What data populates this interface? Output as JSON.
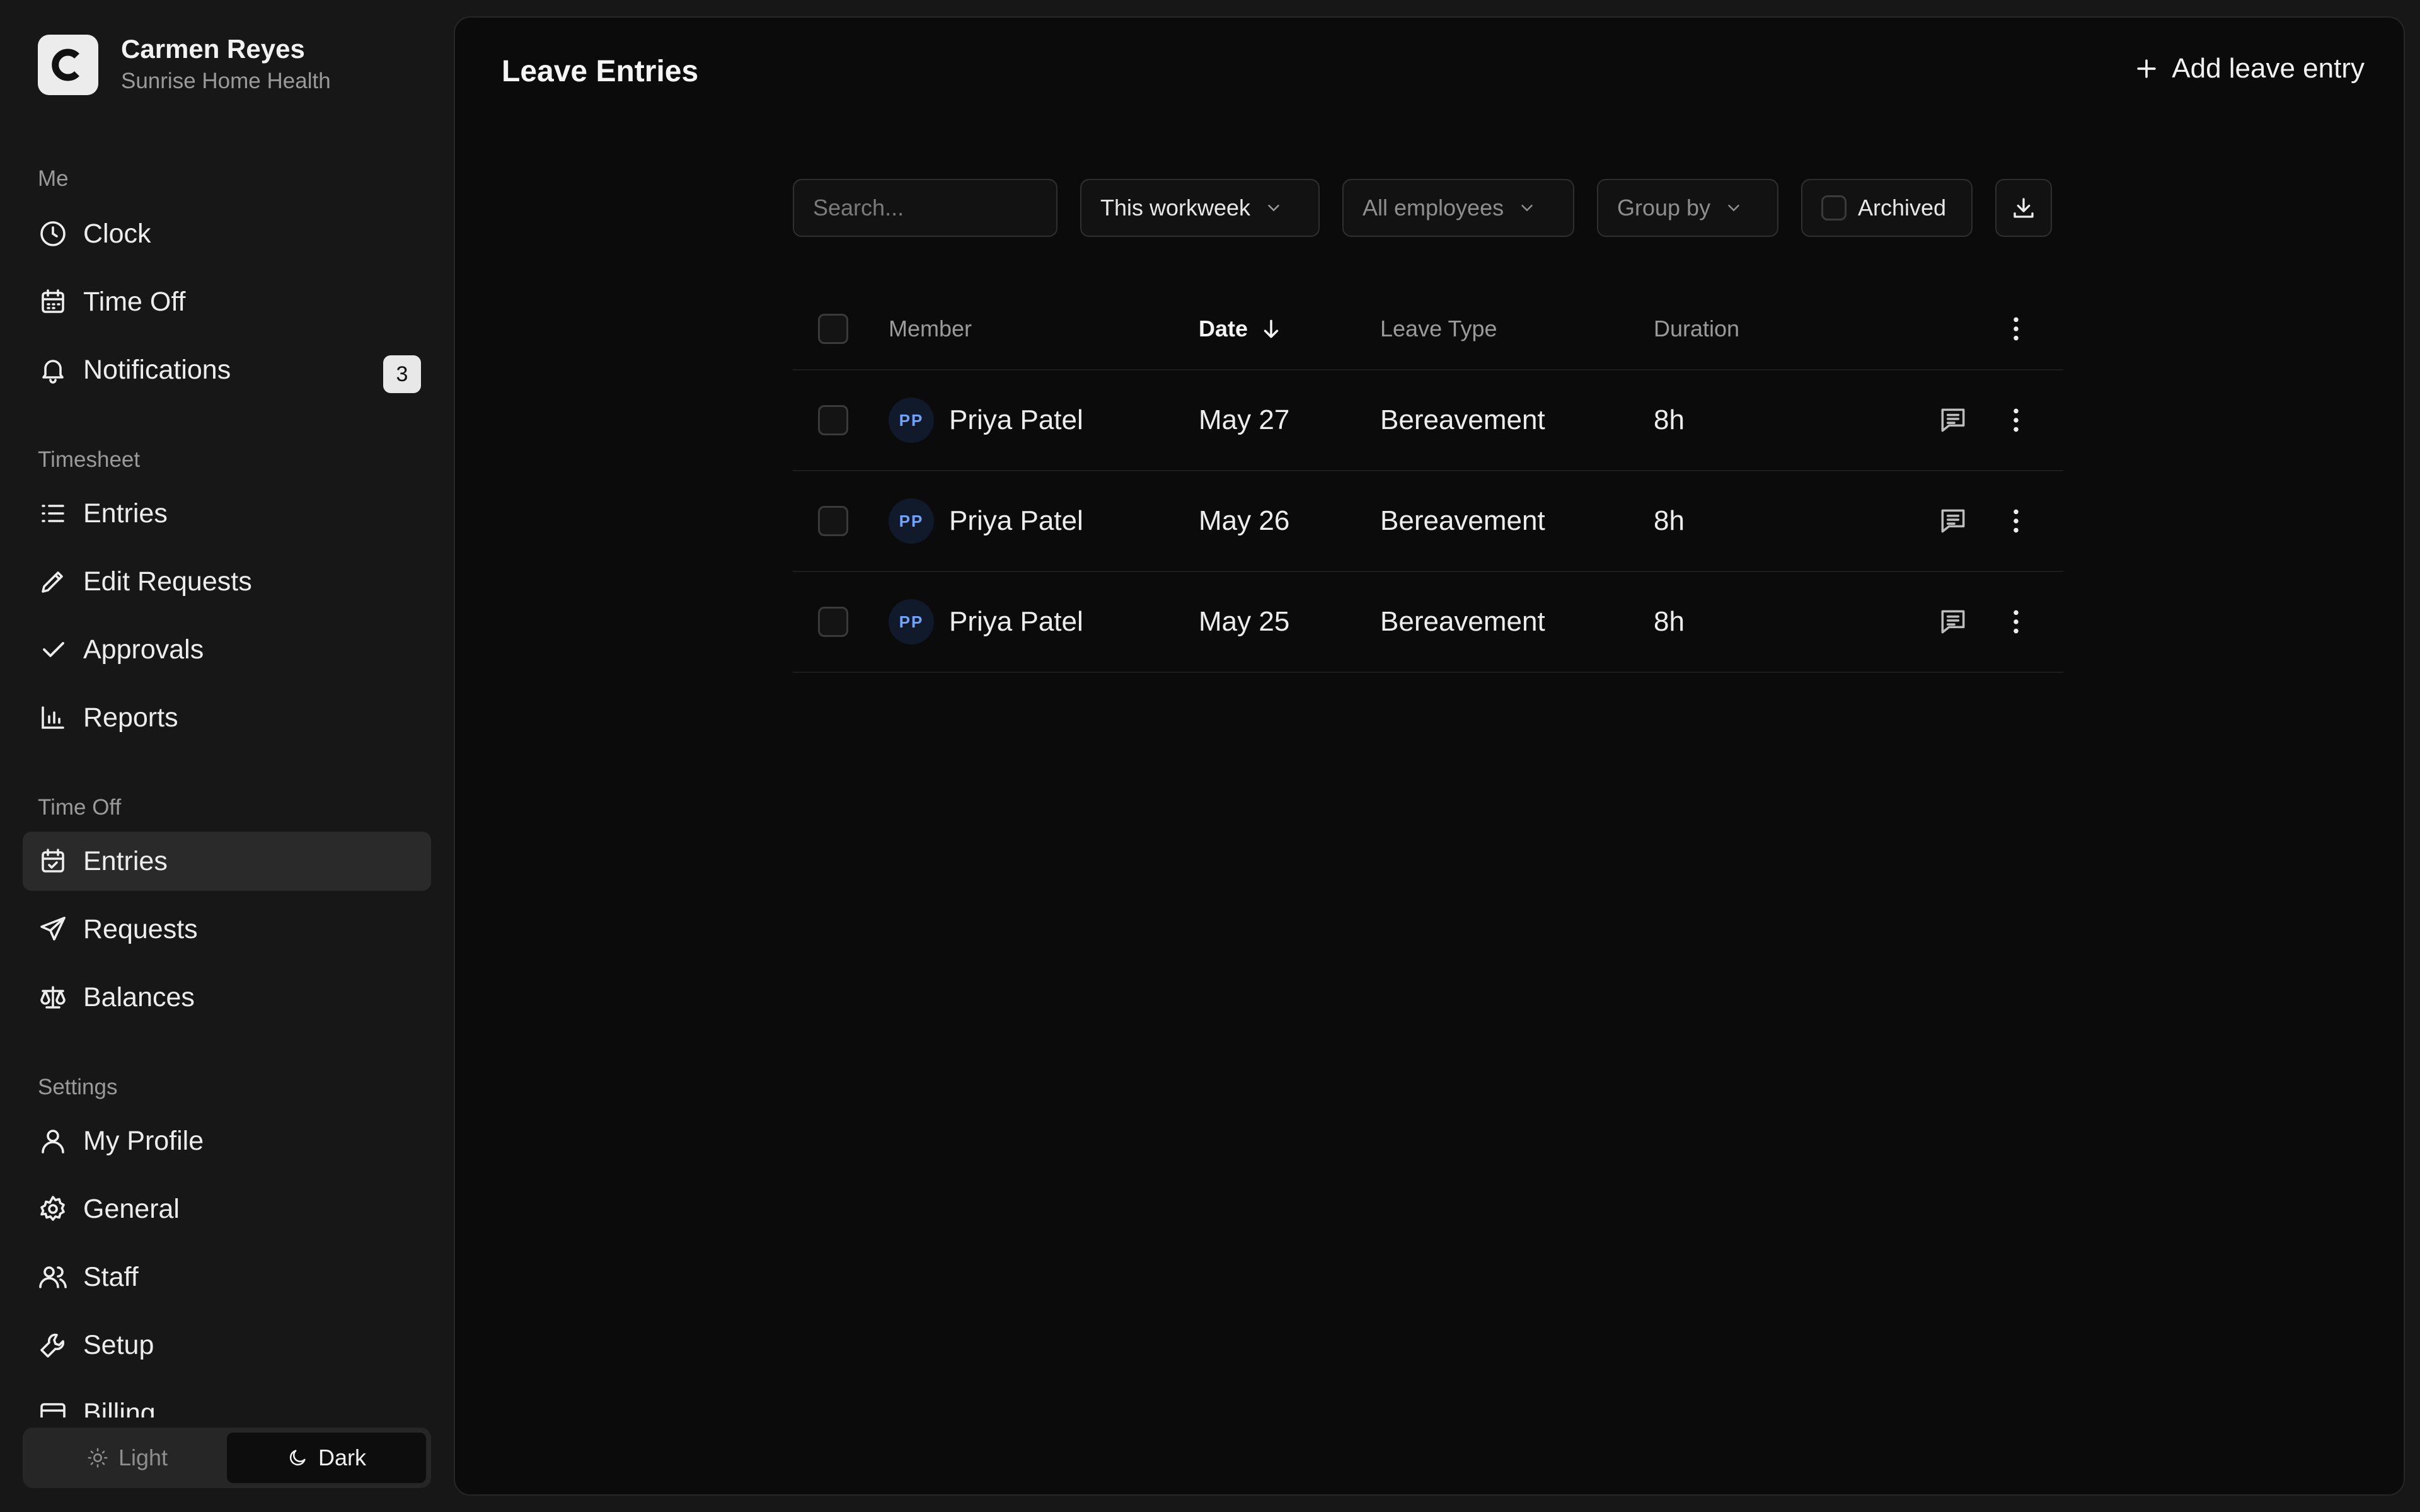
{
  "account": {
    "logo_letter": "C",
    "name": "Carmen Reyes",
    "org": "Sunrise Home Health"
  },
  "sidebar": {
    "sections": [
      {
        "label": "Me",
        "items": [
          {
            "label": "Clock",
            "icon": "clock-icon"
          },
          {
            "label": "Time Off",
            "icon": "calendar-icon"
          },
          {
            "label": "Notifications",
            "icon": "bell-icon",
            "badge": "3"
          }
        ]
      },
      {
        "label": "Timesheet",
        "items": [
          {
            "label": "Entries",
            "icon": "list-icon"
          },
          {
            "label": "Edit Requests",
            "icon": "pencil-icon"
          },
          {
            "label": "Approvals",
            "icon": "check-icon"
          },
          {
            "label": "Reports",
            "icon": "bar-chart-icon"
          }
        ]
      },
      {
        "label": "Time Off",
        "items": [
          {
            "label": "Entries",
            "icon": "calendar-check-icon",
            "active": true
          },
          {
            "label": "Requests",
            "icon": "send-icon"
          },
          {
            "label": "Balances",
            "icon": "scale-icon"
          }
        ]
      },
      {
        "label": "Settings",
        "items": [
          {
            "label": "My Profile",
            "icon": "user-icon"
          },
          {
            "label": "General",
            "icon": "gear-icon"
          },
          {
            "label": "Staff",
            "icon": "users-icon"
          },
          {
            "label": "Setup",
            "icon": "wrench-icon"
          },
          {
            "label": "Billing",
            "icon": "credit-card-icon"
          }
        ]
      }
    ]
  },
  "theme": {
    "light_label": "Light",
    "dark_label": "Dark",
    "selected": "Dark"
  },
  "page": {
    "title": "Leave Entries",
    "add_label": "Add leave entry"
  },
  "filters": {
    "search_placeholder": "Search...",
    "period": "This workweek",
    "employees": "All employees",
    "group_by": "Group by",
    "archived_label": "Archived",
    "archived_checked": false
  },
  "table": {
    "columns": {
      "member": "Member",
      "date": "Date",
      "leave_type": "Leave Type",
      "duration": "Duration"
    },
    "sort": {
      "column": "Date",
      "direction": "descending"
    },
    "rows": [
      {
        "initials": "PP",
        "member": "Priya Patel",
        "date": "May 27",
        "leave_type": "Bereavement",
        "duration": "8h"
      },
      {
        "initials": "PP",
        "member": "Priya Patel",
        "date": "May 26",
        "leave_type": "Bereavement",
        "duration": "8h"
      },
      {
        "initials": "PP",
        "member": "Priya Patel",
        "date": "May 25",
        "leave_type": "Bereavement",
        "duration": "8h"
      }
    ]
  }
}
